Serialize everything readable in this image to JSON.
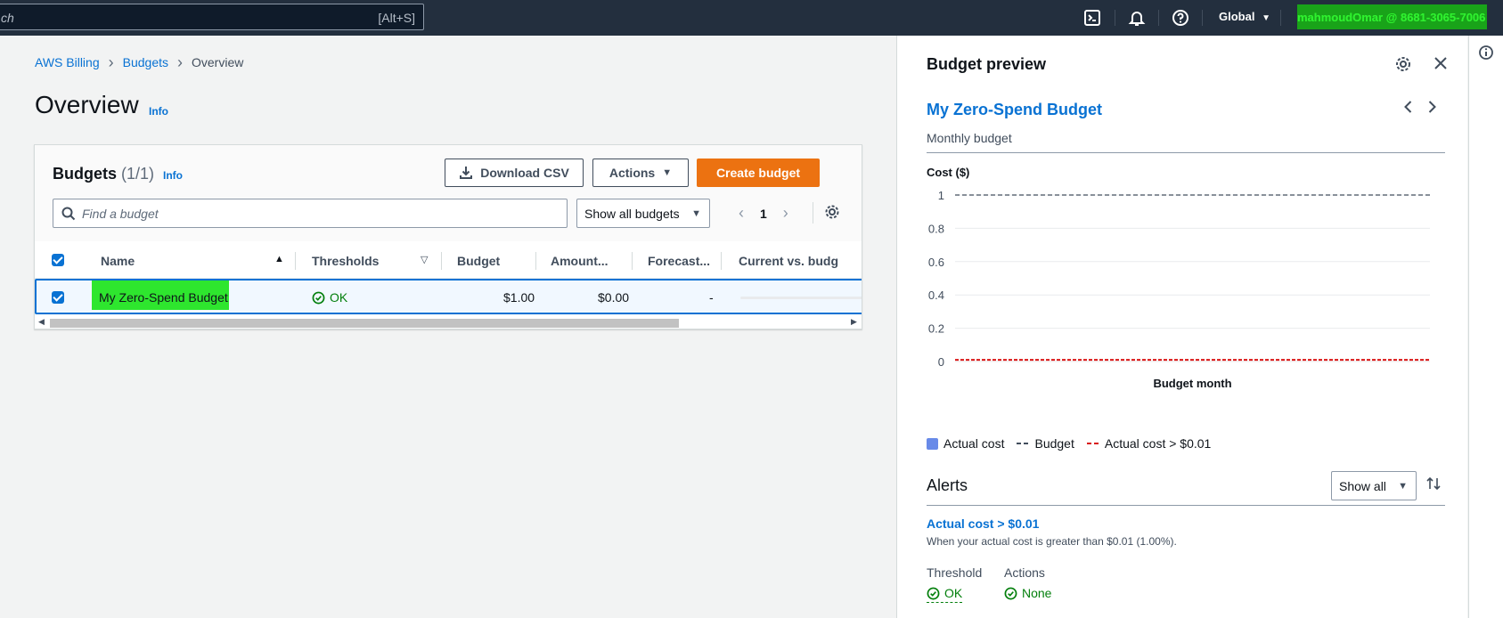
{
  "topnav": {
    "search_placeholder": "ch",
    "search_shortcut": "[Alt+S]",
    "region": "Global",
    "account": "mahmoudOmar @ 8681-3065-7006"
  },
  "breadcrumb": {
    "items": [
      "AWS Billing",
      "Budgets",
      "Overview"
    ]
  },
  "page": {
    "title": "Overview",
    "info": "Info"
  },
  "budgets_table": {
    "title": "Budgets",
    "count": "(1/1)",
    "info": "Info",
    "download_label": "Download CSV",
    "actions_label": "Actions",
    "create_label": "Create budget",
    "find_placeholder": "Find a budget",
    "filter_value": "Show all budgets",
    "page_number": "1",
    "columns": [
      "Name",
      "Thresholds",
      "Budget",
      "Amount...",
      "Forecast...",
      "Current vs. budg"
    ],
    "rows": [
      {
        "name": "My Zero-Spend Budget",
        "threshold": "OK",
        "budget": "$1.00",
        "amount": "$0.00",
        "forecast": "-"
      }
    ]
  },
  "preview": {
    "title": "Budget preview",
    "budget_name": "My Zero-Spend Budget",
    "budget_type": "Monthly budget",
    "legend": [
      "Actual cost",
      "Budget",
      "Actual cost > $0.01"
    ],
    "alerts_title": "Alerts",
    "alerts_filter": "Show all",
    "alert_name": "Actual cost > $0.01",
    "alert_desc": "When your actual cost is greater than $0.01 (1.00%).",
    "threshold_label": "Threshold",
    "threshold_value": "OK",
    "actions_label": "Actions",
    "actions_value": "None"
  },
  "chart_data": {
    "type": "line",
    "ylabel": "Cost ($)",
    "xlabel": "Budget month",
    "ylim": [
      0,
      1
    ],
    "yticks": [
      "1",
      "0.8",
      "0.6",
      "0.4",
      "0.2",
      "0"
    ],
    "series": [
      {
        "name": "Budget",
        "values": [
          1,
          1
        ],
        "color": "#414d5c",
        "style": "dashed"
      },
      {
        "name": "Actual cost > $0.01",
        "values": [
          0.01,
          0.01
        ],
        "color": "#d91515",
        "style": "dashed"
      }
    ],
    "grid": true
  },
  "colors": {
    "nav_bg": "#232f3e",
    "link": "#0972d3",
    "primary": "#ec7211",
    "success": "#037f0c",
    "highlight": "#2ee62e"
  }
}
